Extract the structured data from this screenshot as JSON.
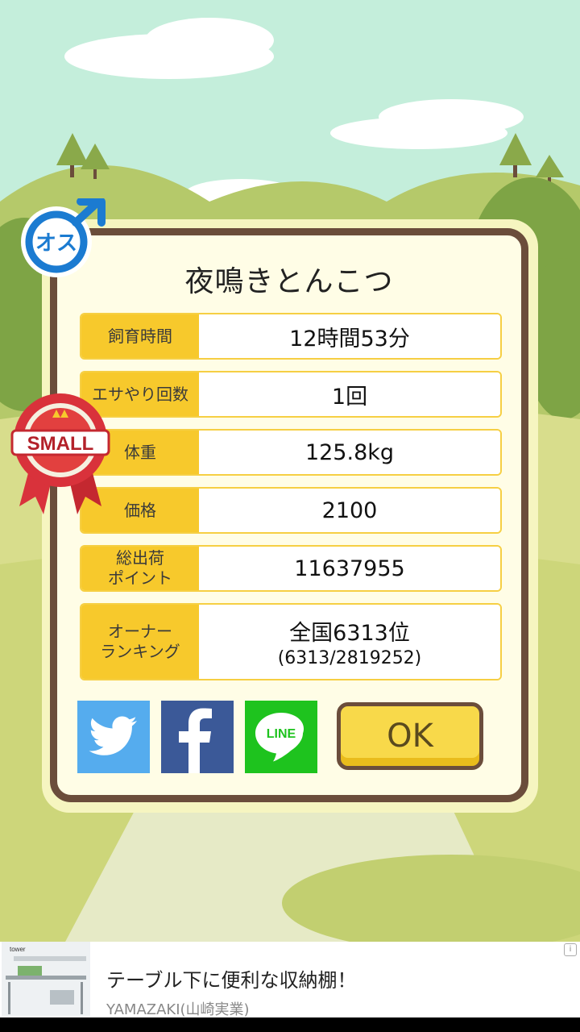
{
  "dialog": {
    "title": "夜鳴きとんこつ",
    "rows": [
      {
        "label": "飼育時間",
        "value": "12時間53分"
      },
      {
        "label": "エサやり回数",
        "value": "1回"
      },
      {
        "label": "体重",
        "value": "125.8kg"
      },
      {
        "label": "価格",
        "value": "2100"
      },
      {
        "label": "総出荷\nポイント",
        "value": "11637955"
      },
      {
        "label": "オーナー\nランキング",
        "value": "全国6313位",
        "sub": "(6313/2819252)"
      }
    ],
    "ok_label": "OK"
  },
  "badges": {
    "gender_text": "オス",
    "ribbon_text": "SMALL"
  },
  "social": {
    "twitter_icon": "twitter-icon",
    "facebook_icon": "facebook-icon",
    "line_icon": "line-icon",
    "line_text": "LINE"
  },
  "ad": {
    "brand": "tower",
    "title": "テーブル下に便利な収納棚！",
    "advertiser": "YAMAZAKI(山崎実業)",
    "info_icon": "i"
  },
  "colors": {
    "sky": "#c4eedb",
    "label_bg": "#f7c92c",
    "frame": "#6b4d3b",
    "ok_button": "#f8d94a",
    "twitter": "#55acee",
    "facebook": "#3b5998",
    "line": "#1ec31e"
  }
}
